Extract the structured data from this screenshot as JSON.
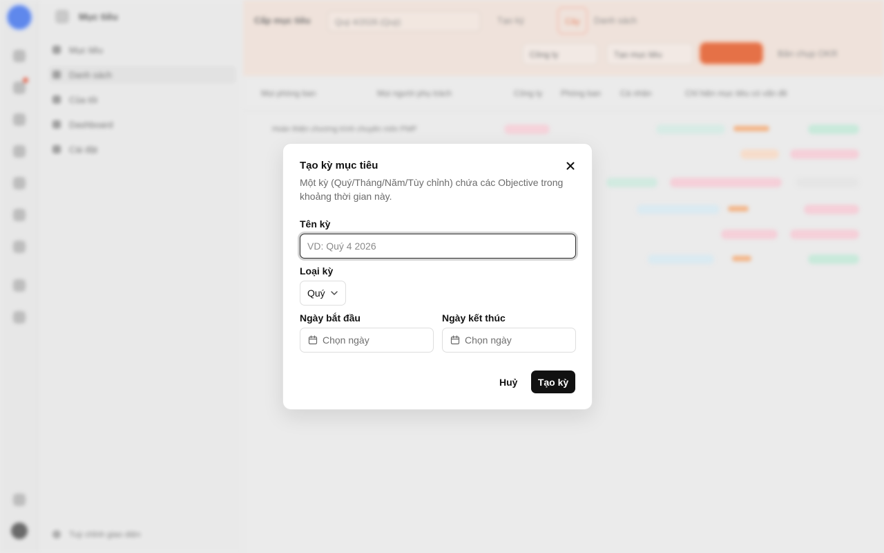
{
  "background": {
    "sidebar_title": "Mục tiêu",
    "sidebar_items": [
      "Mục tiêu",
      "Danh sách",
      "Của tôi",
      "Dashboard",
      "Cài đặt"
    ],
    "sidebar_footer": "Tuỳ chỉnh giao diện",
    "topbar_label": "Cấp mục tiêu",
    "period_select": "Quý 4/2026 (Quý)",
    "tabs": [
      "Tạo kỳ",
      "Cây",
      "Danh sách"
    ],
    "company_select": "Công ty",
    "add_objective": "Tạo mục tiêu",
    "snapshot": "Bản chụp OKR",
    "filters": [
      "Mọi phòng ban",
      "Mọi người phụ trách",
      "Công ty",
      "Phòng ban",
      "Cá nhân",
      "Chỉ hiện mục tiêu có vấn đề"
    ],
    "first_row": "Hoàn thiện chương trình chuyên môn PMP"
  },
  "dialog": {
    "title": "Tạo kỳ mục tiêu",
    "description": "Một kỳ (Quý/Tháng/Năm/Tùy chỉnh) chứa các Objective trong khoảng thời gian này.",
    "name_label": "Tên kỳ",
    "name_placeholder": "VD: Quý 4 2026",
    "type_label": "Loại kỳ",
    "type_value": "Quý",
    "start_label": "Ngày bắt đầu",
    "start_placeholder": "Chọn ngày",
    "end_label": "Ngày kết thúc",
    "end_placeholder": "Chọn ngày",
    "cancel": "Huỷ",
    "submit": "Tạo kỳ"
  },
  "colors": {
    "accent": "#e0521f",
    "primary_button": "#111111"
  }
}
